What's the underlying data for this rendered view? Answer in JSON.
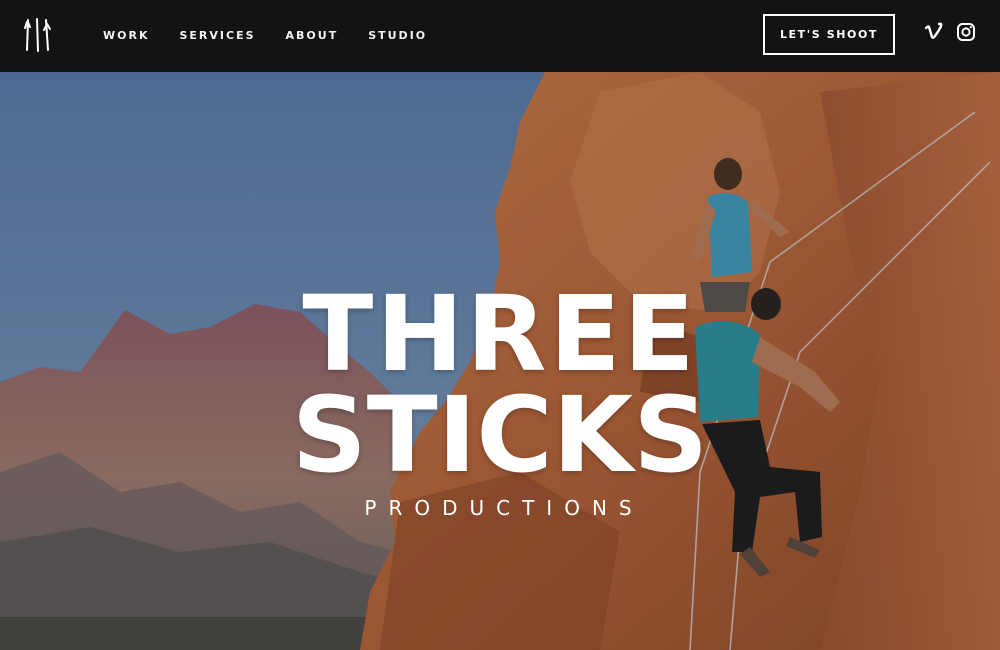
{
  "brand": {
    "logo_icon": "three-sticks-logo-icon"
  },
  "nav": {
    "items": [
      {
        "label": "WORK"
      },
      {
        "label": "SERVICES"
      },
      {
        "label": "ABOUT"
      },
      {
        "label": "STUDIO"
      }
    ],
    "cta_label": "LET'S SHOOT",
    "social": [
      {
        "icon": "vimeo-icon"
      },
      {
        "icon": "instagram-icon"
      }
    ]
  },
  "hero": {
    "title_line_1": "THREE",
    "title_line_2": "STICKS",
    "subtitle": "PRODUCTIONS"
  },
  "colors": {
    "nav_bg": "#121313",
    "text": "#ffffff",
    "sky": "#5d7fa8",
    "rock": "#b5623a",
    "mountain": "#9a6a6a"
  }
}
